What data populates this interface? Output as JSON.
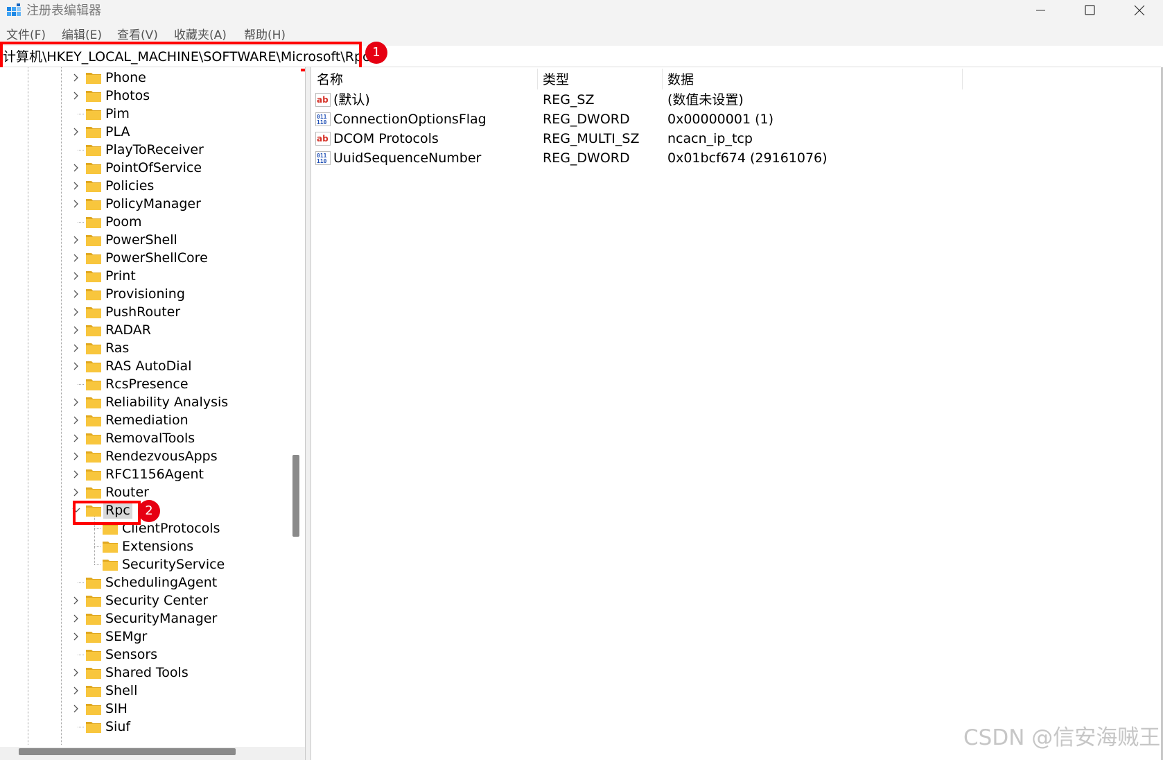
{
  "window": {
    "title": "注册表编辑器",
    "minimize_icon": "minimize-icon",
    "maximize_icon": "maximize-icon",
    "close_icon": "close-icon"
  },
  "menu": [
    "文件(F)",
    "编辑(E)",
    "查看(V)",
    "收藏夹(A)",
    "帮助(H)"
  ],
  "address": {
    "path": "计算机\\HKEY_LOCAL_MACHINE\\SOFTWARE\\Microsoft\\Rpc"
  },
  "annotations": {
    "badge1": "1",
    "badge2": "2",
    "highlight_color": "#ff0000",
    "badge_color": "#e60012"
  },
  "tree": {
    "items": [
      {
        "label": "Phone",
        "expander": "collapsed",
        "level": 0
      },
      {
        "label": "Photos",
        "expander": "collapsed",
        "level": 0
      },
      {
        "label": "Pim",
        "expander": "none",
        "level": 0
      },
      {
        "label": "PLA",
        "expander": "collapsed",
        "level": 0
      },
      {
        "label": "PlayToReceiver",
        "expander": "none",
        "level": 0
      },
      {
        "label": "PointOfService",
        "expander": "collapsed",
        "level": 0
      },
      {
        "label": "Policies",
        "expander": "collapsed",
        "level": 0
      },
      {
        "label": "PolicyManager",
        "expander": "collapsed",
        "level": 0
      },
      {
        "label": "Poom",
        "expander": "none",
        "level": 0
      },
      {
        "label": "PowerShell",
        "expander": "collapsed",
        "level": 0
      },
      {
        "label": "PowerShellCore",
        "expander": "collapsed",
        "level": 0
      },
      {
        "label": "Print",
        "expander": "collapsed",
        "level": 0
      },
      {
        "label": "Provisioning",
        "expander": "collapsed",
        "level": 0
      },
      {
        "label": "PushRouter",
        "expander": "collapsed",
        "level": 0
      },
      {
        "label": "RADAR",
        "expander": "collapsed",
        "level": 0
      },
      {
        "label": "Ras",
        "expander": "collapsed",
        "level": 0
      },
      {
        "label": "RAS AutoDial",
        "expander": "collapsed",
        "level": 0
      },
      {
        "label": "RcsPresence",
        "expander": "none",
        "level": 0
      },
      {
        "label": "Reliability Analysis",
        "expander": "collapsed",
        "level": 0
      },
      {
        "label": "Remediation",
        "expander": "collapsed",
        "level": 0
      },
      {
        "label": "RemovalTools",
        "expander": "collapsed",
        "level": 0
      },
      {
        "label": "RendezvousApps",
        "expander": "collapsed",
        "level": 0
      },
      {
        "label": "RFC1156Agent",
        "expander": "collapsed",
        "level": 0
      },
      {
        "label": "Router",
        "expander": "collapsed",
        "level": 0
      },
      {
        "label": "Rpc",
        "expander": "expanded",
        "level": 0,
        "selected": true
      },
      {
        "label": "ClientProtocols",
        "expander": "none",
        "level": 1
      },
      {
        "label": "Extensions",
        "expander": "none",
        "level": 1
      },
      {
        "label": "SecurityService",
        "expander": "none",
        "level": 1
      },
      {
        "label": "SchedulingAgent",
        "expander": "none",
        "level": 0
      },
      {
        "label": "Security Center",
        "expander": "collapsed",
        "level": 0
      },
      {
        "label": "SecurityManager",
        "expander": "collapsed",
        "level": 0
      },
      {
        "label": "SEMgr",
        "expander": "collapsed",
        "level": 0
      },
      {
        "label": "Sensors",
        "expander": "none",
        "level": 0
      },
      {
        "label": "Shared Tools",
        "expander": "collapsed",
        "level": 0
      },
      {
        "label": "Shell",
        "expander": "collapsed",
        "level": 0
      },
      {
        "label": "SIH",
        "expander": "collapsed",
        "level": 0
      },
      {
        "label": "Siuf",
        "expander": "none",
        "level": 0
      }
    ],
    "folder_color": "#f8c63d"
  },
  "values": {
    "headers": {
      "name": "名称",
      "type": "类型",
      "data": "数据"
    },
    "rows": [
      {
        "icon": "string-value-icon",
        "name": "(默认)",
        "type": "REG_SZ",
        "data": "(数值未设置)"
      },
      {
        "icon": "binary-value-icon",
        "name": "ConnectionOptionsFlag",
        "type": "REG_DWORD",
        "data": "0x00000001 (1)"
      },
      {
        "icon": "string-value-icon",
        "name": "DCOM Protocols",
        "type": "REG_MULTI_SZ",
        "data": "ncacn_ip_tcp"
      },
      {
        "icon": "binary-value-icon",
        "name": "UuidSequenceNumber",
        "type": "REG_DWORD",
        "data": "0x01bcf674 (29161076)"
      }
    ]
  },
  "watermark": "CSDN @信安海贼王"
}
